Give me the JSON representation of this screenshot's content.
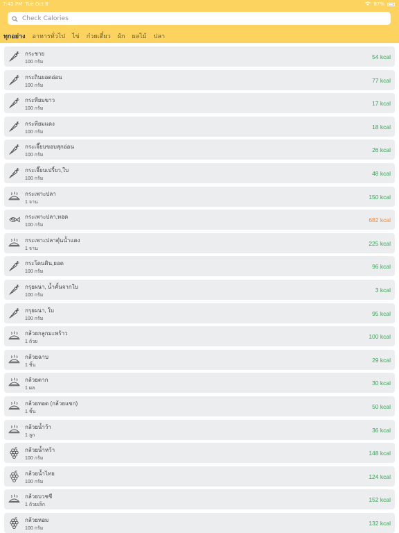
{
  "status_bar": {
    "time": "7:42 PM",
    "date": "Tue Oct 8",
    "battery": "87%"
  },
  "search": {
    "placeholder": "Check Calories"
  },
  "tabs": [
    {
      "label": "ทุกอย่าง",
      "active": true
    },
    {
      "label": "อาหารทั่วไป",
      "active": false
    },
    {
      "label": "ไข่",
      "active": false
    },
    {
      "label": "ก๋วยเตี๋ยว",
      "active": false
    },
    {
      "label": "ผัก",
      "active": false
    },
    {
      "label": "ผลไม้",
      "active": false
    },
    {
      "label": "ปลา",
      "active": false
    }
  ],
  "colors": {
    "header": "#fbd35e",
    "kcal_normal": "#3aa35a",
    "kcal_high": "#f08a3c",
    "row_bg": "#ecedee"
  },
  "foods": [
    {
      "name": "กระชาย",
      "portion": "100 กรัม",
      "kcal": "54 kcal",
      "icon": "carrot-icon",
      "level": "normal"
    },
    {
      "name": "กระถินยอดอ่อน",
      "portion": "100 กรัม",
      "kcal": "77 kcal",
      "icon": "carrot-icon",
      "level": "normal"
    },
    {
      "name": "กระทียมขาว",
      "portion": "100 กรัม",
      "kcal": "17 kcal",
      "icon": "carrot-icon",
      "level": "normal"
    },
    {
      "name": "กระทียมแดง",
      "portion": "100 กรัม",
      "kcal": "18 kcal",
      "icon": "carrot-icon",
      "level": "normal"
    },
    {
      "name": "กระเจี๊ยบขอบสุกอ่อน",
      "portion": "100 กรัม",
      "kcal": "26 kcal",
      "icon": "carrot-icon",
      "level": "normal"
    },
    {
      "name": "กระเจี๊ยบเปรี้ยว,ใบ",
      "portion": "100 กรัม",
      "kcal": "48 kcal",
      "icon": "carrot-icon",
      "level": "normal"
    },
    {
      "name": "กระเพาะปลา",
      "portion": "1 จาน",
      "kcal": "150 kcal",
      "icon": "hot-dish-icon",
      "level": "normal"
    },
    {
      "name": "กระเพาะปลา,ทอด",
      "portion": "100 กรัม",
      "kcal": "682 kcal",
      "icon": "fish-icon",
      "level": "high"
    },
    {
      "name": "กระเพาะปลาตุ๋นน้ำแดง",
      "portion": "1 จาน",
      "kcal": "225 kcal",
      "icon": "hot-dish-icon",
      "level": "normal"
    },
    {
      "name": "กระโดนดิน,ยอด",
      "portion": "100 กรัม",
      "kcal": "96 kcal",
      "icon": "carrot-icon",
      "level": "normal"
    },
    {
      "name": "กรุยผนา, น้ำคั้นจากใบ",
      "portion": "100 กรัม",
      "kcal": "3 kcal",
      "icon": "carrot-icon",
      "level": "normal"
    },
    {
      "name": "กรุยผนา, ใบ",
      "portion": "100 กรัม",
      "kcal": "95 kcal",
      "icon": "carrot-icon",
      "level": "normal"
    },
    {
      "name": "กล้วยกลูกมะพร้าว",
      "portion": "1 ถ้วย",
      "kcal": "100 kcal",
      "icon": "hot-dish-icon",
      "level": "normal"
    },
    {
      "name": "กล้วยฉาบ",
      "portion": "1 ชิ้น",
      "kcal": "29 kcal",
      "icon": "hot-dish-icon",
      "level": "normal"
    },
    {
      "name": "กล้วยตาก",
      "portion": "1 ผล",
      "kcal": "30 kcal",
      "icon": "hot-dish-icon",
      "level": "normal"
    },
    {
      "name": "กล้วยทอด (กล้วยแขก)",
      "portion": "1 ชิ้น",
      "kcal": "50 kcal",
      "icon": "hot-dish-icon",
      "level": "normal"
    },
    {
      "name": "กล้วยน้ำว้า",
      "portion": "1 ลูก",
      "kcal": "36 kcal",
      "icon": "hot-dish-icon",
      "level": "normal"
    },
    {
      "name": "กล้วยน้ำหว้า",
      "portion": "100 กรัม",
      "kcal": "148 kcal",
      "icon": "grapes-icon",
      "level": "normal"
    },
    {
      "name": "กล้วยน้ำไทย",
      "portion": "100 กรัม",
      "kcal": "124 kcal",
      "icon": "grapes-icon",
      "level": "normal"
    },
    {
      "name": "กล้วยบวชชี",
      "portion": "1 ถ้วยเล็ก",
      "kcal": "152 kcal",
      "icon": "hot-dish-icon",
      "level": "normal"
    },
    {
      "name": "กล้วยหอม",
      "portion": "100 กรัม",
      "kcal": "132 kcal",
      "icon": "grapes-icon",
      "level": "normal"
    }
  ]
}
